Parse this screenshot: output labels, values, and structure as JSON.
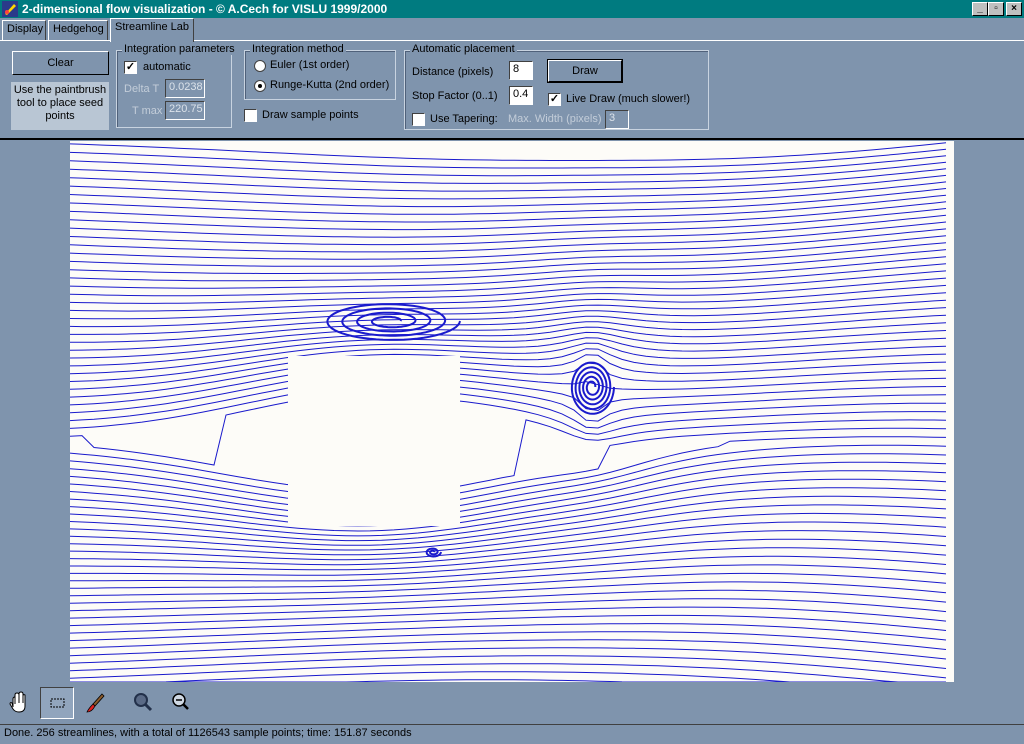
{
  "window": {
    "title": "2-dimensional flow visualization - © A.Cech for VISLU 1999/2000",
    "controls": {
      "minimize": "_",
      "restore": "▫",
      "close": "×"
    }
  },
  "tabs": [
    "Display",
    "Hedgehog",
    "Streamline Lab"
  ],
  "active_tab": "Streamline Lab",
  "clear_button": "Clear",
  "hint_text": "Use the paintbrush tool to place seed points",
  "integration_parameters": {
    "title": "Integration parameters",
    "automatic_label": "automatic",
    "automatic_checked": true,
    "delta_t_label": "Delta T",
    "delta_t_value": "0.0238",
    "t_max_label": "T max",
    "t_max_value": "220.75"
  },
  "integration_method": {
    "title": "Integration method",
    "options": [
      "Euler (1st order)",
      "Runge-Kutta (2nd order)"
    ],
    "selected": "Runge-Kutta (2nd order)"
  },
  "draw_sample_points": {
    "label": "Draw sample points",
    "checked": false
  },
  "automatic_placement": {
    "title": "Automatic placement",
    "distance_label": "Distance (pixels)",
    "distance_value": "8",
    "stop_factor_label": "Stop Factor (0..1)",
    "stop_factor_value": "0.4",
    "draw_button": "Draw",
    "live_draw_label": "Live Draw (much slower!)",
    "live_draw_checked": true,
    "use_tapering_label": "Use Tapering:",
    "use_tapering_checked": false,
    "max_width_label": "Max. Width (pixels)",
    "max_width_value": "3"
  },
  "toolbar": {
    "tools": [
      "hand-tool",
      "rectangle-select-tool",
      "paintbrush-tool",
      "zoom-in-tool",
      "zoom-out-tool"
    ],
    "active_tool": "rectangle-select-tool"
  },
  "status": "Done. 256 streamlines, with a total of 1126543 sample points; time: 151.87 seconds",
  "colors": {
    "streamline": "#1a1acc",
    "background": "#7f94ad",
    "titlebar": "#007b80",
    "canvas": "#fdfcf8"
  }
}
